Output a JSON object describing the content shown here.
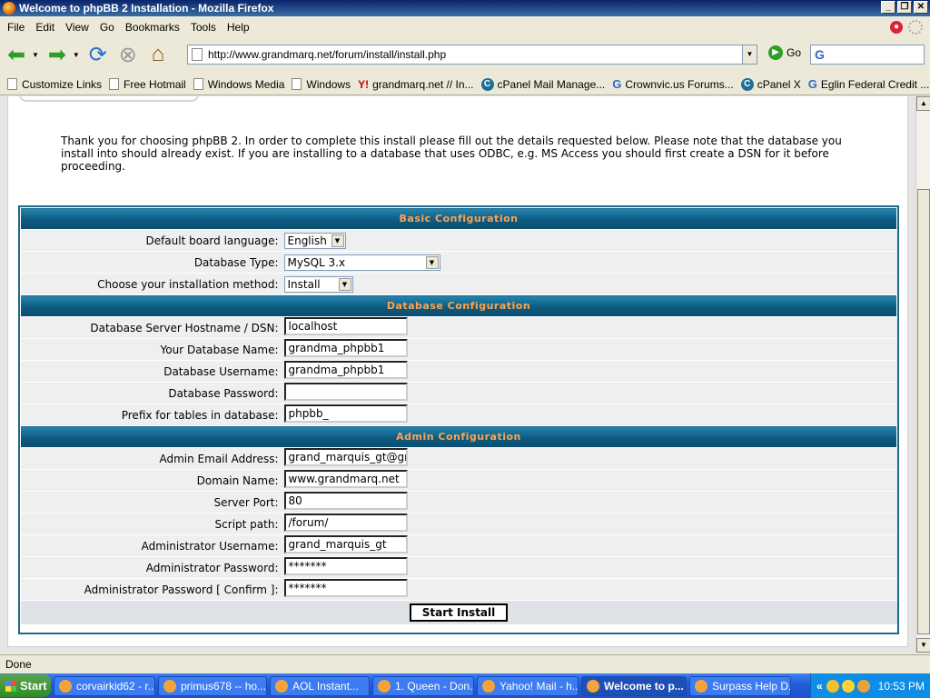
{
  "window": {
    "title": "Welcome to phpBB 2 Installation - Mozilla Firefox"
  },
  "menu": [
    "File",
    "Edit",
    "View",
    "Go",
    "Bookmarks",
    "Tools",
    "Help"
  ],
  "nav": {
    "url": "http://www.grandmarq.net/forum/install/install.php",
    "go_label": "Go",
    "search_placeholder": ""
  },
  "bookmarks": [
    {
      "label": "Customize Links",
      "icon": "page-icon"
    },
    {
      "label": "Free Hotmail",
      "icon": "page-icon"
    },
    {
      "label": "Windows Media",
      "icon": "page-icon"
    },
    {
      "label": "Windows",
      "icon": "page-icon"
    },
    {
      "label": "grandmarq.net // In...",
      "icon": "yahoo-icon"
    },
    {
      "label": "cPanel Mail Manage...",
      "icon": "cpanel-icon"
    },
    {
      "label": "Crownvic.us Forums...",
      "icon": "google-icon"
    },
    {
      "label": "cPanel X",
      "icon": "cpanel-icon"
    },
    {
      "label": "Eglin Federal Credit ...",
      "icon": "google-icon"
    }
  ],
  "intro": "Thank you for choosing phpBB 2. In order to complete this install please fill out the details requested below. Please note that the database you install into should already exist. If you are installing to a database that uses ODBC, e.g. MS Access you should first create a DSN for it before proceeding.",
  "basic": {
    "header": "Basic Configuration",
    "language_label": "Default board language:",
    "language_value": "English",
    "dbtype_label": "Database Type:",
    "dbtype_value": "MySQL 3.x",
    "method_label": "Choose your installation method:",
    "method_value": "Install"
  },
  "database": {
    "header": "Database Configuration",
    "host_label": "Database Server Hostname / DSN:",
    "host_value": "localhost",
    "name_label": "Your Database Name:",
    "name_value": "grandma_phpbb1",
    "user_label": "Database Username:",
    "user_value": "grandma_phpbb1",
    "pass_label": "Database Password:",
    "pass_value": "",
    "prefix_label": "Prefix for tables in database:",
    "prefix_value": "phpbb_"
  },
  "admin": {
    "header": "Admin Configuration",
    "email_label": "Admin Email Address:",
    "email_value": "grand_marquis_gt@gra",
    "domain_label": "Domain Name:",
    "domain_value": "www.grandmarq.net",
    "port_label": "Server Port:",
    "port_value": "80",
    "script_label": "Script path:",
    "script_value": "/forum/",
    "username_label": "Administrator Username:",
    "username_value": "grand_marquis_gt",
    "password_label": "Administrator Password:",
    "password_value": "*******",
    "confirm_label": "Administrator Password [ Confirm ]:",
    "confirm_value": "*******"
  },
  "submit_label": "Start Install",
  "status": "Done",
  "taskbar": {
    "start_label": "Start",
    "tasks": [
      "corvairkid62 - r...",
      "primus678 -- ho...",
      "AOL Instant...",
      "1. Queen - Don...",
      "Yahoo! Mail - h...",
      "Welcome to p...",
      "Surpass Help D..."
    ],
    "tray_chevron": "«",
    "clock": "10:53 PM"
  }
}
